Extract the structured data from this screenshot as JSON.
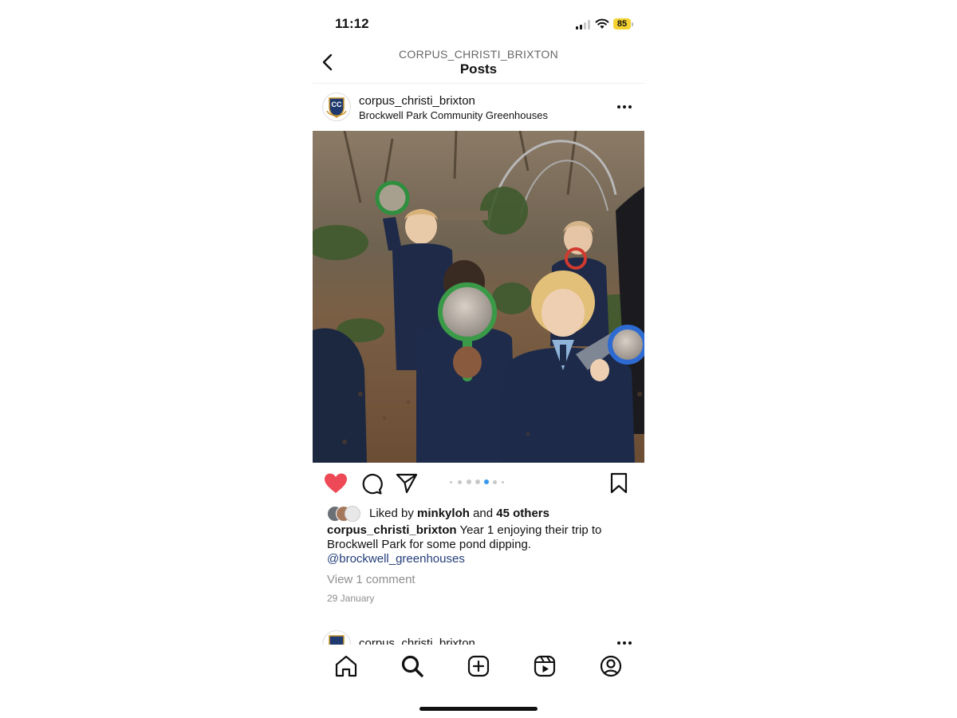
{
  "status_bar": {
    "time": "11:12",
    "battery": "85"
  },
  "header": {
    "subtitle": "CORPUS_CHRISTI_BRIXTON",
    "title": "Posts"
  },
  "post": {
    "username": "corpus_christi_brixton",
    "location": "Brockwell Park Community Greenhouses",
    "avatar_text": "CC",
    "liked": true,
    "carousel": {
      "count": 7,
      "active_index": 4
    },
    "likes": {
      "prefix": "Liked by ",
      "user": "minkyloh",
      "joiner": " and ",
      "others": "45 others"
    },
    "caption": {
      "username": "corpus_christi_brixton",
      "text": " Year 1 enjoying their trip to Brockwell Park for some pond dipping.",
      "mention": "@brockwell_greenhouses"
    },
    "view_comments": "View 1 comment",
    "date": "29 January"
  },
  "next_post": {
    "username": "corpus_christi_brixton"
  },
  "tabs": [
    "home",
    "search",
    "create",
    "reels",
    "profile"
  ],
  "colors": {
    "heart": "#ed4956",
    "mention": "#233d7a",
    "active_dot": "#3897f0",
    "battery": "#f5d232"
  }
}
